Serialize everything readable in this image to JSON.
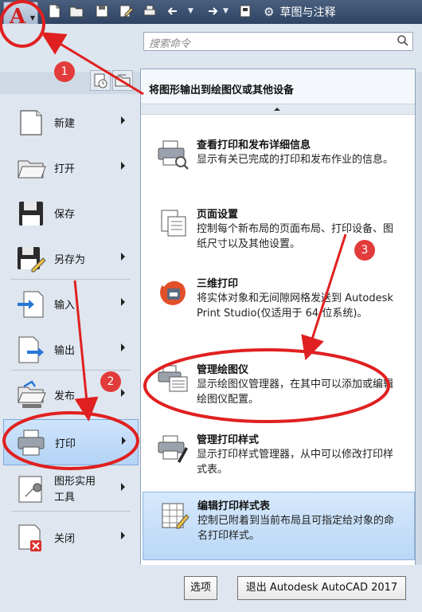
{
  "titlebar": {
    "workspace": "草图与注释"
  },
  "search": {
    "placeholder": "搜索命令"
  },
  "left_menu": [
    {
      "label": "新建",
      "icon": "new-document-icon",
      "has_submenu": true
    },
    {
      "label": "打开",
      "icon": "open-folder-icon",
      "has_submenu": true
    },
    {
      "label": "保存",
      "icon": "floppy-disk-icon",
      "has_submenu": false
    },
    {
      "label": "另存为",
      "icon": "save-as-icon",
      "has_submenu": true
    },
    {
      "label": "输入",
      "icon": "import-icon",
      "has_submenu": true
    },
    {
      "label": "输出",
      "icon": "export-icon",
      "has_submenu": true
    },
    {
      "label": "发布",
      "icon": "publish-icon",
      "has_submenu": true
    },
    {
      "label": "打印",
      "icon": "printer-icon",
      "has_submenu": true,
      "highlighted": true
    },
    {
      "label": "图形实用工具",
      "line1": "图形实用",
      "line2": "工具",
      "icon": "wrench-icon",
      "has_submenu": true
    },
    {
      "label": "关闭",
      "icon": "close-document-icon",
      "has_submenu": true
    }
  ],
  "submenu": {
    "title": "将图形输出到绘图仪或其他设备",
    "items": [
      {
        "title": "查看打印和发布详细信息",
        "desc": "显示有关已完成的打印和发布作业的信息。",
        "icon": "print-details-icon"
      },
      {
        "title": "页面设置",
        "desc": "控制每个新布局的页面布局、打印设备、图纸尺寸以及其他设置。",
        "icon": "page-setup-icon"
      },
      {
        "title": "三维打印",
        "desc": "将实体对象和无间隙网格发送到 Autodesk Print Studio(仅适用于 64 位系统)。",
        "icon": "3d-print-icon"
      },
      {
        "title": "管理绘图仪",
        "desc": "显示绘图仪管理器，在其中可以添加或编辑绘图仪配置。",
        "icon": "plotter-manager-icon"
      },
      {
        "title": "管理打印样式",
        "desc": "显示打印样式管理器，从中可以修改打印样式表。",
        "icon": "print-style-manager-icon"
      },
      {
        "title": "编辑打印样式表",
        "desc": "控制已附着到当前布局且可指定给对象的命名打印样式。",
        "icon": "edit-print-style-table-icon",
        "selected": true
      }
    ]
  },
  "footer": {
    "options_label": "选项",
    "exit_label": "退出 Autodesk AutoCAD 2017"
  },
  "annotations": {
    "badge1": "1",
    "badge2": "2",
    "badge3": "3",
    "color": "#e02020"
  }
}
